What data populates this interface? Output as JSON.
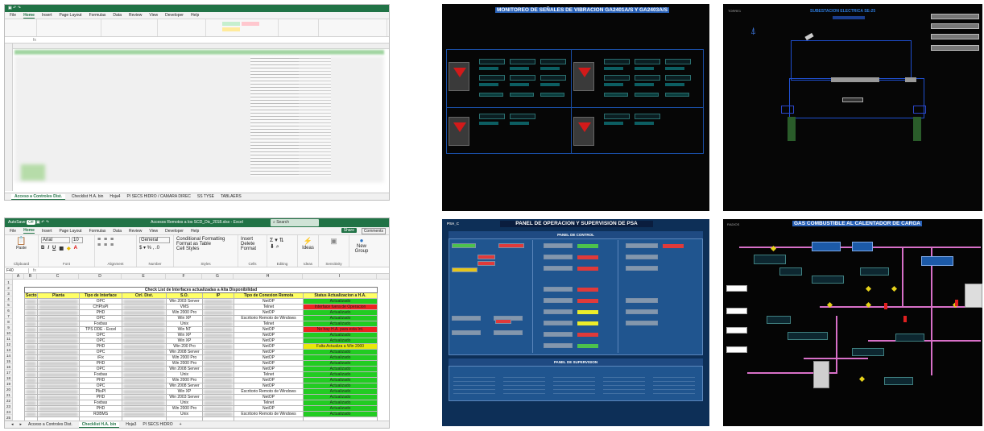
{
  "excel_top": {
    "ribbon_tabs": [
      "File",
      "Home",
      "Insert",
      "Page Layout",
      "Formulas",
      "Data",
      "Review",
      "View",
      "Developer",
      "Help"
    ],
    "sheet_tabs": [
      "Acceso a Controles Dist.",
      "Checklist H.A. bin",
      "Hoja4",
      "PI SECS HIDRO / CAMARA DIREC",
      "SS TYSE",
      "TABLAERS"
    ]
  },
  "excel_bottom": {
    "title": "Accesos Remotos a los SCD_Dic_2018.xlsx - Excel",
    "autosave": "AutoSave",
    "autosave_state": "Off",
    "ribbon_tabs": [
      "File",
      "Home",
      "Insert",
      "Page Layout",
      "Formulas",
      "Data",
      "Review",
      "View",
      "Developer",
      "Help"
    ],
    "search": "Search",
    "share": "Share",
    "comments": "Comments",
    "groups": [
      "Clipboard",
      "Font",
      "Alignment",
      "Number",
      "Styles",
      "Cells",
      "Editing",
      "Ideas",
      "Sensitivity"
    ],
    "paste": "Paste",
    "font_name": "Arial",
    "font_size": "10",
    "number_format": "General",
    "styles_items": [
      "Conditional Formatting",
      "Format as Table",
      "Cell Styles"
    ],
    "cells_items": [
      "Insert",
      "Delete",
      "Format"
    ],
    "ideas": "Ideas",
    "new_group": "New Group",
    "namebox": "F40",
    "columns": [
      "A",
      "B",
      "C",
      "D",
      "E",
      "F",
      "G",
      "H",
      "I"
    ],
    "sheet_title": "Check List de Interfaces actualizadas a Alta Disponibilidad",
    "headers": [
      "Sector",
      "Planta",
      "Tipo de Interface",
      "Ctrl. Dist.",
      "S.O.",
      "IP",
      "Tipo de Conexion Remota",
      "Status Actualizacion a H.A."
    ],
    "rows": [
      [
        "OPC",
        "",
        "Win 2003 Server",
        "",
        "NetOP",
        "Actualizado"
      ],
      [
        "CHPIsPI",
        "",
        "VMS",
        "",
        "Telnet",
        "Interface fuera de Operacion"
      ],
      [
        "PHD",
        "",
        "Win 2000 Pro",
        "",
        "NetOP",
        "Actualizado"
      ],
      [
        "OPC",
        "",
        "Win XP",
        "",
        "Escritorio Remoto de Windows",
        "Actualizado"
      ],
      [
        "Foxbas",
        "",
        "Unix",
        "",
        "Telnet",
        "Actualizado"
      ],
      [
        "TPS DDE - Excel",
        "",
        "Win NT",
        "",
        "NetOP",
        "No hay H.A. para esta Int."
      ],
      [
        "OPC",
        "",
        "Win XP",
        "",
        "NetOP",
        "Actualizado"
      ],
      [
        "OPC",
        "",
        "Win XP",
        "",
        "NetOP",
        "Actualizado"
      ],
      [
        "PHD",
        "",
        "Win 200 Pro",
        "",
        "NetOP",
        "Falta Actualiza a Win 2000"
      ],
      [
        "OPC",
        "",
        "Win 2008 Server",
        "",
        "NetOP",
        "Actualizado"
      ],
      [
        "iFix",
        "",
        "Win 2000 Pro",
        "",
        "NetOP",
        "Actualizado"
      ],
      [
        "PHD",
        "",
        "Win 2000 Pro",
        "",
        "NetOP",
        "Actualizado"
      ],
      [
        "OPC",
        "",
        "Win 2008 Server",
        "",
        "NetOP",
        "Actualizado"
      ],
      [
        "Foxbas",
        "",
        "Unix",
        "",
        "Telnet",
        "Actualizado"
      ],
      [
        "PHD",
        "",
        "Win 2000 Pro",
        "",
        "NetOP",
        "Actualizado"
      ],
      [
        "OPC",
        "",
        "Win 2008 Server",
        "",
        "NetOP",
        "Actualizado"
      ],
      [
        "PlisPI",
        "",
        "Win XP",
        "",
        "Escritorio Remoto de Windows",
        "Actualizado"
      ],
      [
        "PHD",
        "",
        "Win 2003 Server",
        "",
        "NetOP",
        "Actualizado"
      ],
      [
        "Foxbas",
        "",
        "Unix",
        "",
        "Telnet",
        "Actualizado"
      ],
      [
        "PHD",
        "",
        "Win 2000 Pro",
        "",
        "NetOP",
        "Actualizado"
      ],
      [
        "RDBMS",
        "",
        "Unix",
        "",
        "Escritorio Remoto de Windows",
        "Actualizado"
      ]
    ],
    "status_colors": {
      "Actualizado": "#22cc22",
      "Interface fuera de Operacion": "#ee2222",
      "No hay H.A. para esta Int.": "#ee2222",
      "Falta Actualiza a Win 2000": "#e8e80a"
    },
    "row_numbers": [
      "1",
      "2",
      "3",
      "4",
      "5",
      "6",
      "7",
      "8",
      "9",
      "10",
      "11",
      "12",
      "13",
      "14",
      "15",
      "16",
      "17",
      "18",
      "19",
      "20",
      "21",
      "22",
      "23",
      "24",
      "25",
      "26",
      "27"
    ],
    "sheet_tabs": [
      "Acceso a Controles Dist.",
      "Checklist H.A. bin",
      "Hoja3",
      "PI SECS HIDRO"
    ],
    "add_sheet": "+"
  },
  "vibration": {
    "title": "MONITOREO DE SEÑALES DE VIBRACION GA2401A/S Y GA2403A/S"
  },
  "substation": {
    "title": "SUBESTACION ELECTRICA SE-25",
    "corner": "TORRE1"
  },
  "psa": {
    "corner": "PSA_C",
    "title": "PANEL DE OPERACION Y SUPERVISION DE PSA",
    "control_header": "PANEL DE CONTROL",
    "supervision_header": "PANEL DE SUPERVISION"
  },
  "gas": {
    "corner": "RADIOS",
    "title": "GAS COMBUSTIBLE AL CALENTADOR DE CARGA"
  },
  "colors": {
    "excel_green": "#217346",
    "scada_bg": "#060606",
    "psa_bg": "#0d2f57",
    "pipe": "#d870c8"
  }
}
